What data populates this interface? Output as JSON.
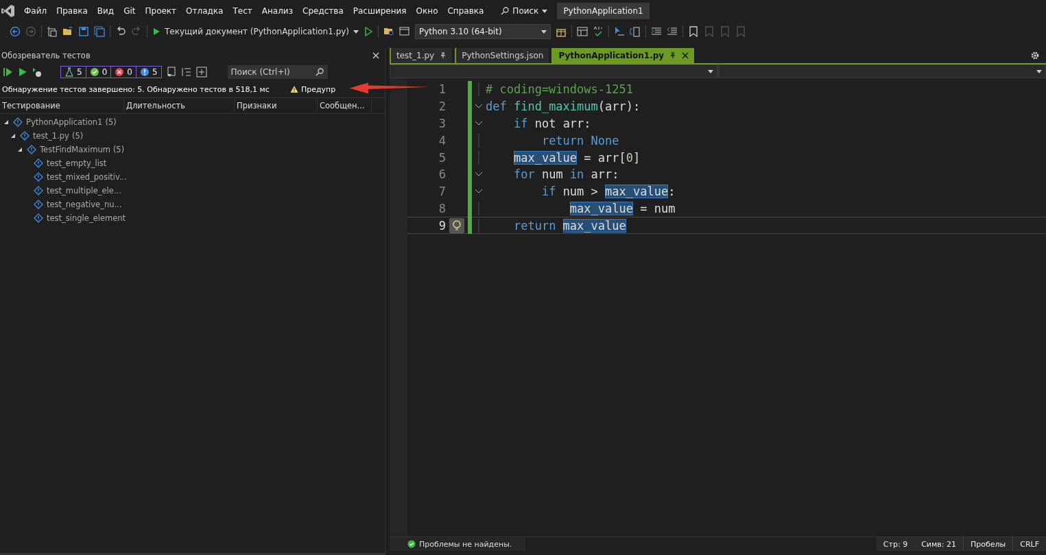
{
  "menu": {
    "items": [
      "Файл",
      "Правка",
      "Вид",
      "Git",
      "Проект",
      "Отладка",
      "Тест",
      "Анализ",
      "Средства",
      "Расширения",
      "Окно",
      "Справка"
    ],
    "search": "Поиск",
    "solution": "PythonApplication1"
  },
  "toolbar": {
    "run_target": "Текущий документ (PythonApplication1.py)",
    "interpreter": "Python 3.10 (64-bit)"
  },
  "test_explorer": {
    "title": "Обозреватель тестов",
    "counters": [
      {
        "kind": "total",
        "count": "5"
      },
      {
        "kind": "passed",
        "count": "0"
      },
      {
        "kind": "failed",
        "count": "0"
      },
      {
        "kind": "not_run",
        "count": "5"
      }
    ],
    "search": {
      "placeholder": "Поиск (Ctrl+I)"
    },
    "status": "Обнаружение тестов завершено: 5. Обнаружено тестов в 518,1 мс",
    "warning": "Предупр",
    "columns": [
      "Тестирование",
      "Длительность",
      "Признаки",
      "Сообщен..."
    ],
    "tree": [
      {
        "name": "PythonApplication1",
        "count": "(5)",
        "expanded": true,
        "children": [
          {
            "name": "test_1.py",
            "count": "(5)",
            "expanded": true,
            "children": [
              {
                "name": "TestFindMaximum",
                "count": "(5)",
                "expanded": true,
                "children": [
                  {
                    "name": "test_empty_list"
                  },
                  {
                    "name": "test_mixed_positiv..."
                  },
                  {
                    "name": "test_multiple_ele..."
                  },
                  {
                    "name": "test_negative_nu..."
                  },
                  {
                    "name": "test_single_element"
                  }
                ]
              }
            ]
          }
        ]
      }
    ]
  },
  "editor": {
    "tabs": [
      {
        "label": "test_1.py",
        "selected": false,
        "pinned": true
      },
      {
        "label": "PythonSettings.json",
        "selected": false,
        "pinned": false
      },
      {
        "label": "PythonApplication1.py",
        "selected": true,
        "pinned": true
      }
    ],
    "lines": [
      {
        "number": "1",
        "fold": false,
        "current": false,
        "tokens": [
          {
            "kind": "comment",
            "text": "# coding=windows-1251"
          }
        ]
      },
      {
        "number": "2",
        "fold": true,
        "current": false,
        "tokens": [
          {
            "kind": "keyword",
            "text": "def "
          },
          {
            "kind": "function",
            "text": "find_maximum"
          },
          {
            "kind": "plain",
            "text": "(arr):"
          }
        ]
      },
      {
        "number": "3",
        "fold": true,
        "current": false,
        "tokens": [
          {
            "kind": "keyword",
            "text": "    if"
          },
          {
            "kind": "plain",
            "text": " not arr:"
          }
        ]
      },
      {
        "number": "4",
        "fold": false,
        "current": false,
        "tokens": [
          {
            "kind": "keyword",
            "text": "        return None"
          }
        ]
      },
      {
        "number": "5",
        "fold": false,
        "current": false,
        "tokens": [
          {
            "kind": "match",
            "text": "    max_value"
          },
          {
            "kind": "plain",
            "text": " = arr["
          },
          {
            "kind": "number",
            "text": "0"
          },
          {
            "kind": "plain",
            "text": "]"
          }
        ]
      },
      {
        "number": "6",
        "fold": true,
        "current": false,
        "tokens": [
          {
            "kind": "keyword",
            "text": "    for"
          },
          {
            "kind": "plain",
            "text": " num "
          },
          {
            "kind": "keyword",
            "text": "in"
          },
          {
            "kind": "plain",
            "text": " arr:"
          }
        ]
      },
      {
        "number": "7",
        "fold": true,
        "current": false,
        "tokens": [
          {
            "kind": "keyword",
            "text": "        if"
          },
          {
            "kind": "plain",
            "text": " num > "
          },
          {
            "kind": "match",
            "text": "max_value"
          },
          {
            "kind": "plain",
            "text": ":"
          }
        ]
      },
      {
        "number": "8",
        "fold": false,
        "current": false,
        "tokens": [
          {
            "kind": "match",
            "text": "            max_value"
          },
          {
            "kind": "plain",
            "text": " = num"
          }
        ]
      },
      {
        "number": "9",
        "fold": false,
        "current": true,
        "tokens": [
          {
            "kind": "keyword",
            "text": "    return "
          },
          {
            "kind": "match",
            "text": "max_value"
          }
        ]
      }
    ]
  },
  "status_bar": {
    "problems": "Проблемы не найдены.",
    "line": "Стр: 9",
    "column": "Симв: 21",
    "indent": "Пробелы",
    "line_ending": "CRLF"
  }
}
